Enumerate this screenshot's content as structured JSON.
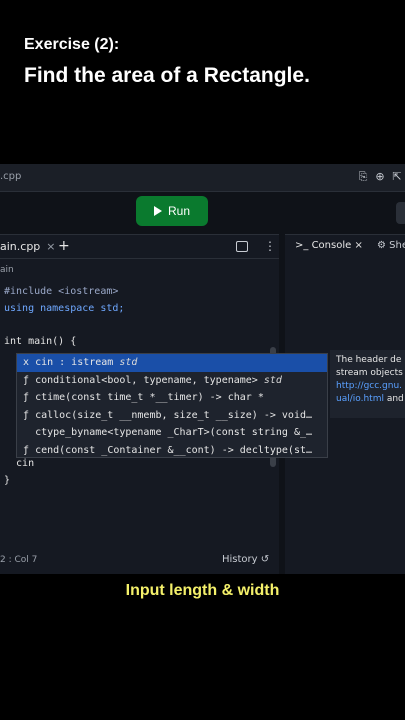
{
  "caption": {
    "exercise": "Exercise (2):",
    "title": "Find the area of a Rectangle.",
    "bottom": "Input length & width"
  },
  "url_bar": {
    "filename": ".cpp"
  },
  "toolbar": {
    "run_label": "Run"
  },
  "editor": {
    "tab_label": "ain.cpp",
    "breadcrumb": "ain",
    "lines": [
      "#include <iostream>",
      "using namespace std;",
      "",
      "int main() {",
      "  cin"
    ],
    "closing_brace": "}",
    "status_position": "2 : Col 7",
    "history_label": "History"
  },
  "console": {
    "tab_label": "Console",
    "shell_label": "She"
  },
  "autocomplete": {
    "items": [
      {
        "kind": "x",
        "name": "cin",
        "detail": " : istream ",
        "type": "std"
      },
      {
        "kind": "ƒ",
        "name": "conditional",
        "detail": "<bool, typename, typename> ",
        "type": "std"
      },
      {
        "kind": "ƒ",
        "name": "ctime",
        "detail": "(const time_t *__timer) -> char *",
        "type": ""
      },
      {
        "kind": "ƒ",
        "name": "calloc",
        "detail": "(size_t __nmemb, size_t __size) -> void…",
        "type": ""
      },
      {
        "kind": " ",
        "name": "ctype_byname",
        "detail": "<typename _CharT>(const string &_…",
        "type": ""
      },
      {
        "kind": "ƒ",
        "name": "cend",
        "detail": "(const _Container &__cont) -> decltype(st…",
        "type": ""
      }
    ]
  },
  "doc_panel": {
    "line1": "The header de",
    "line2": "stream objects",
    "link1": "http://gcc.gnu.",
    "link2": "ual/io.html",
    "line3_suffix": " and"
  }
}
